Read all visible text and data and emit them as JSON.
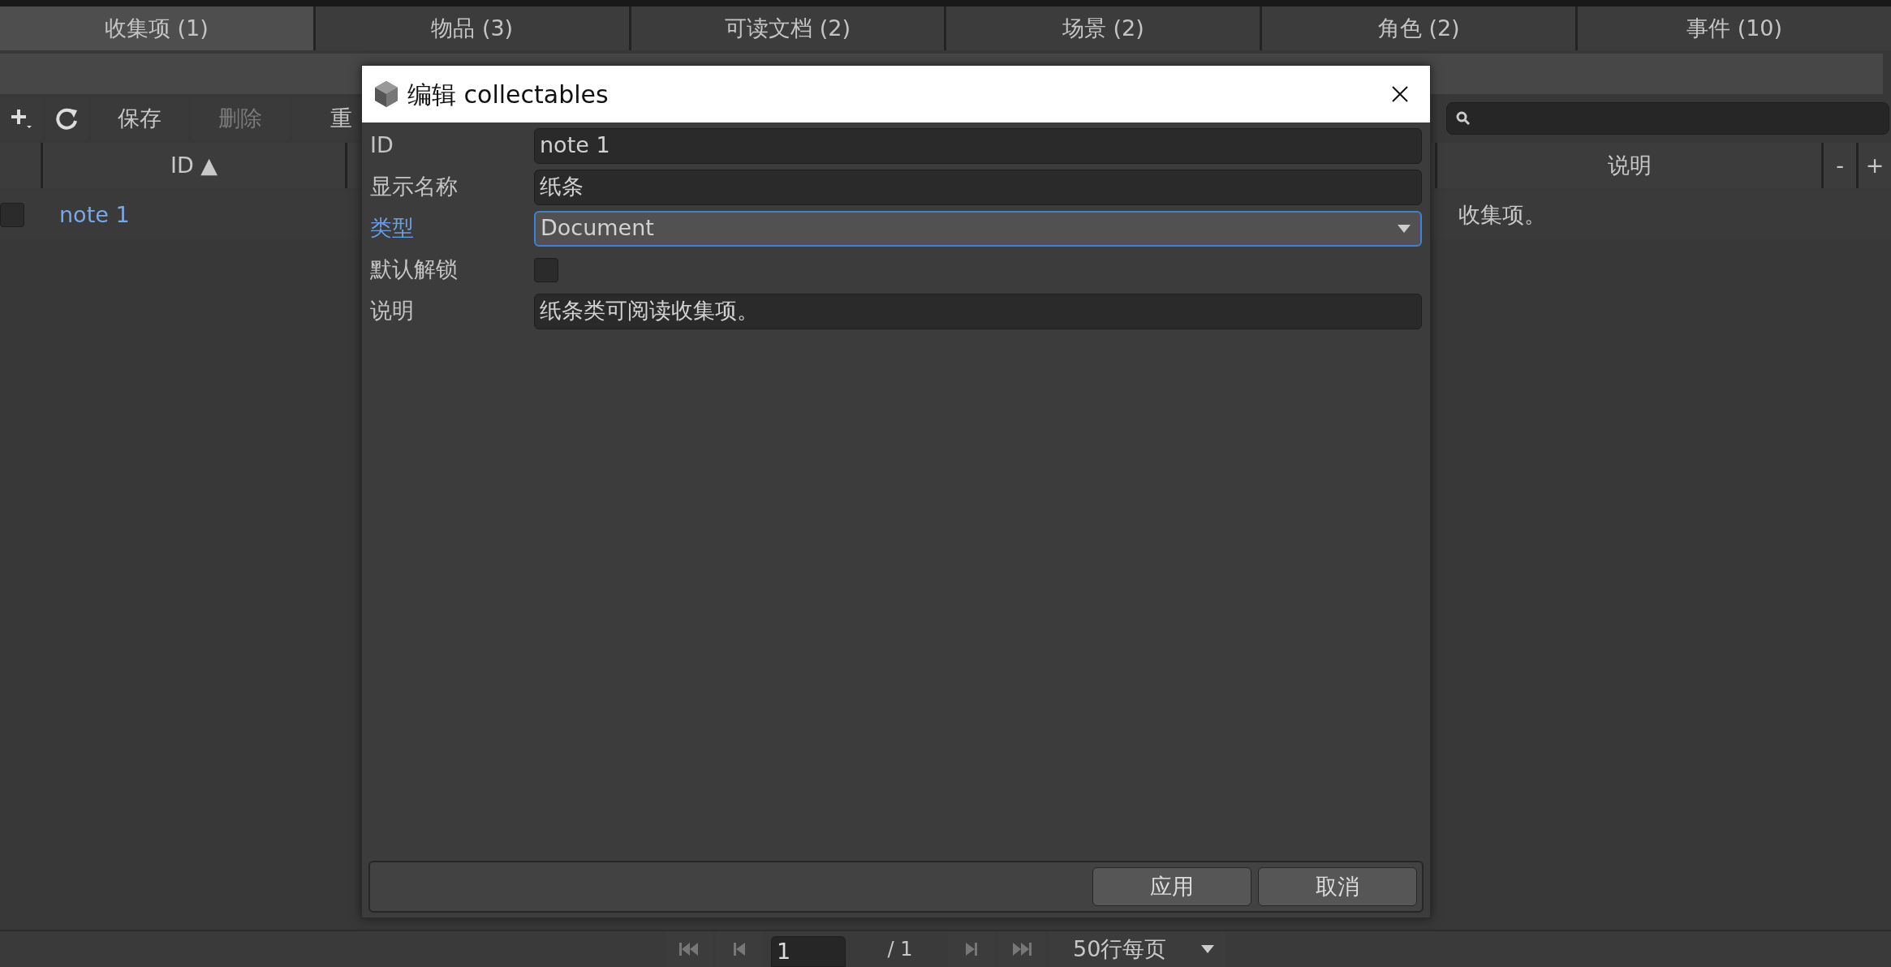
{
  "tabs": [
    {
      "label": "收集项 (1)",
      "selected": true
    },
    {
      "label": "物品 (3)",
      "selected": false
    },
    {
      "label": "可读文档 (2)",
      "selected": false
    },
    {
      "label": "场景 (2)",
      "selected": false
    },
    {
      "label": "角色 (2)",
      "selected": false
    },
    {
      "label": "事件 (10)",
      "selected": false
    }
  ],
  "toolbar": [
    {
      "kind": "add"
    },
    {
      "kind": "refresh"
    },
    {
      "kind": "text",
      "label": "保存",
      "disabled": false
    },
    {
      "kind": "text",
      "label": "删除",
      "disabled": true
    },
    {
      "kind": "text",
      "label": "重",
      "disabled": false
    }
  ],
  "table": {
    "columns": [
      {
        "label": "ID ▲"
      },
      {
        "label": "说明"
      }
    ],
    "column_buttons": [
      "-",
      "+"
    ],
    "rows": [
      {
        "checked": false,
        "id": "note 1",
        "description": "收集项。"
      }
    ]
  },
  "dialog": {
    "title": "编辑 collectables",
    "fields": [
      {
        "kind": "text",
        "label": "ID",
        "value": "note 1",
        "focused": false
      },
      {
        "kind": "text",
        "label": "显示名称",
        "value": "纸条",
        "focused": false
      },
      {
        "kind": "select",
        "label": "类型",
        "value": "Document",
        "focused": true
      },
      {
        "kind": "checkbox",
        "label": "默认解锁",
        "checked": false,
        "focused": false
      },
      {
        "kind": "text",
        "label": "说明",
        "value": "纸条类可阅读收集项。",
        "focused": false
      }
    ],
    "buttons": [
      "应用",
      "取消"
    ]
  },
  "pager": {
    "page": "1",
    "total": "/ 1",
    "per_page": "50行每页"
  }
}
